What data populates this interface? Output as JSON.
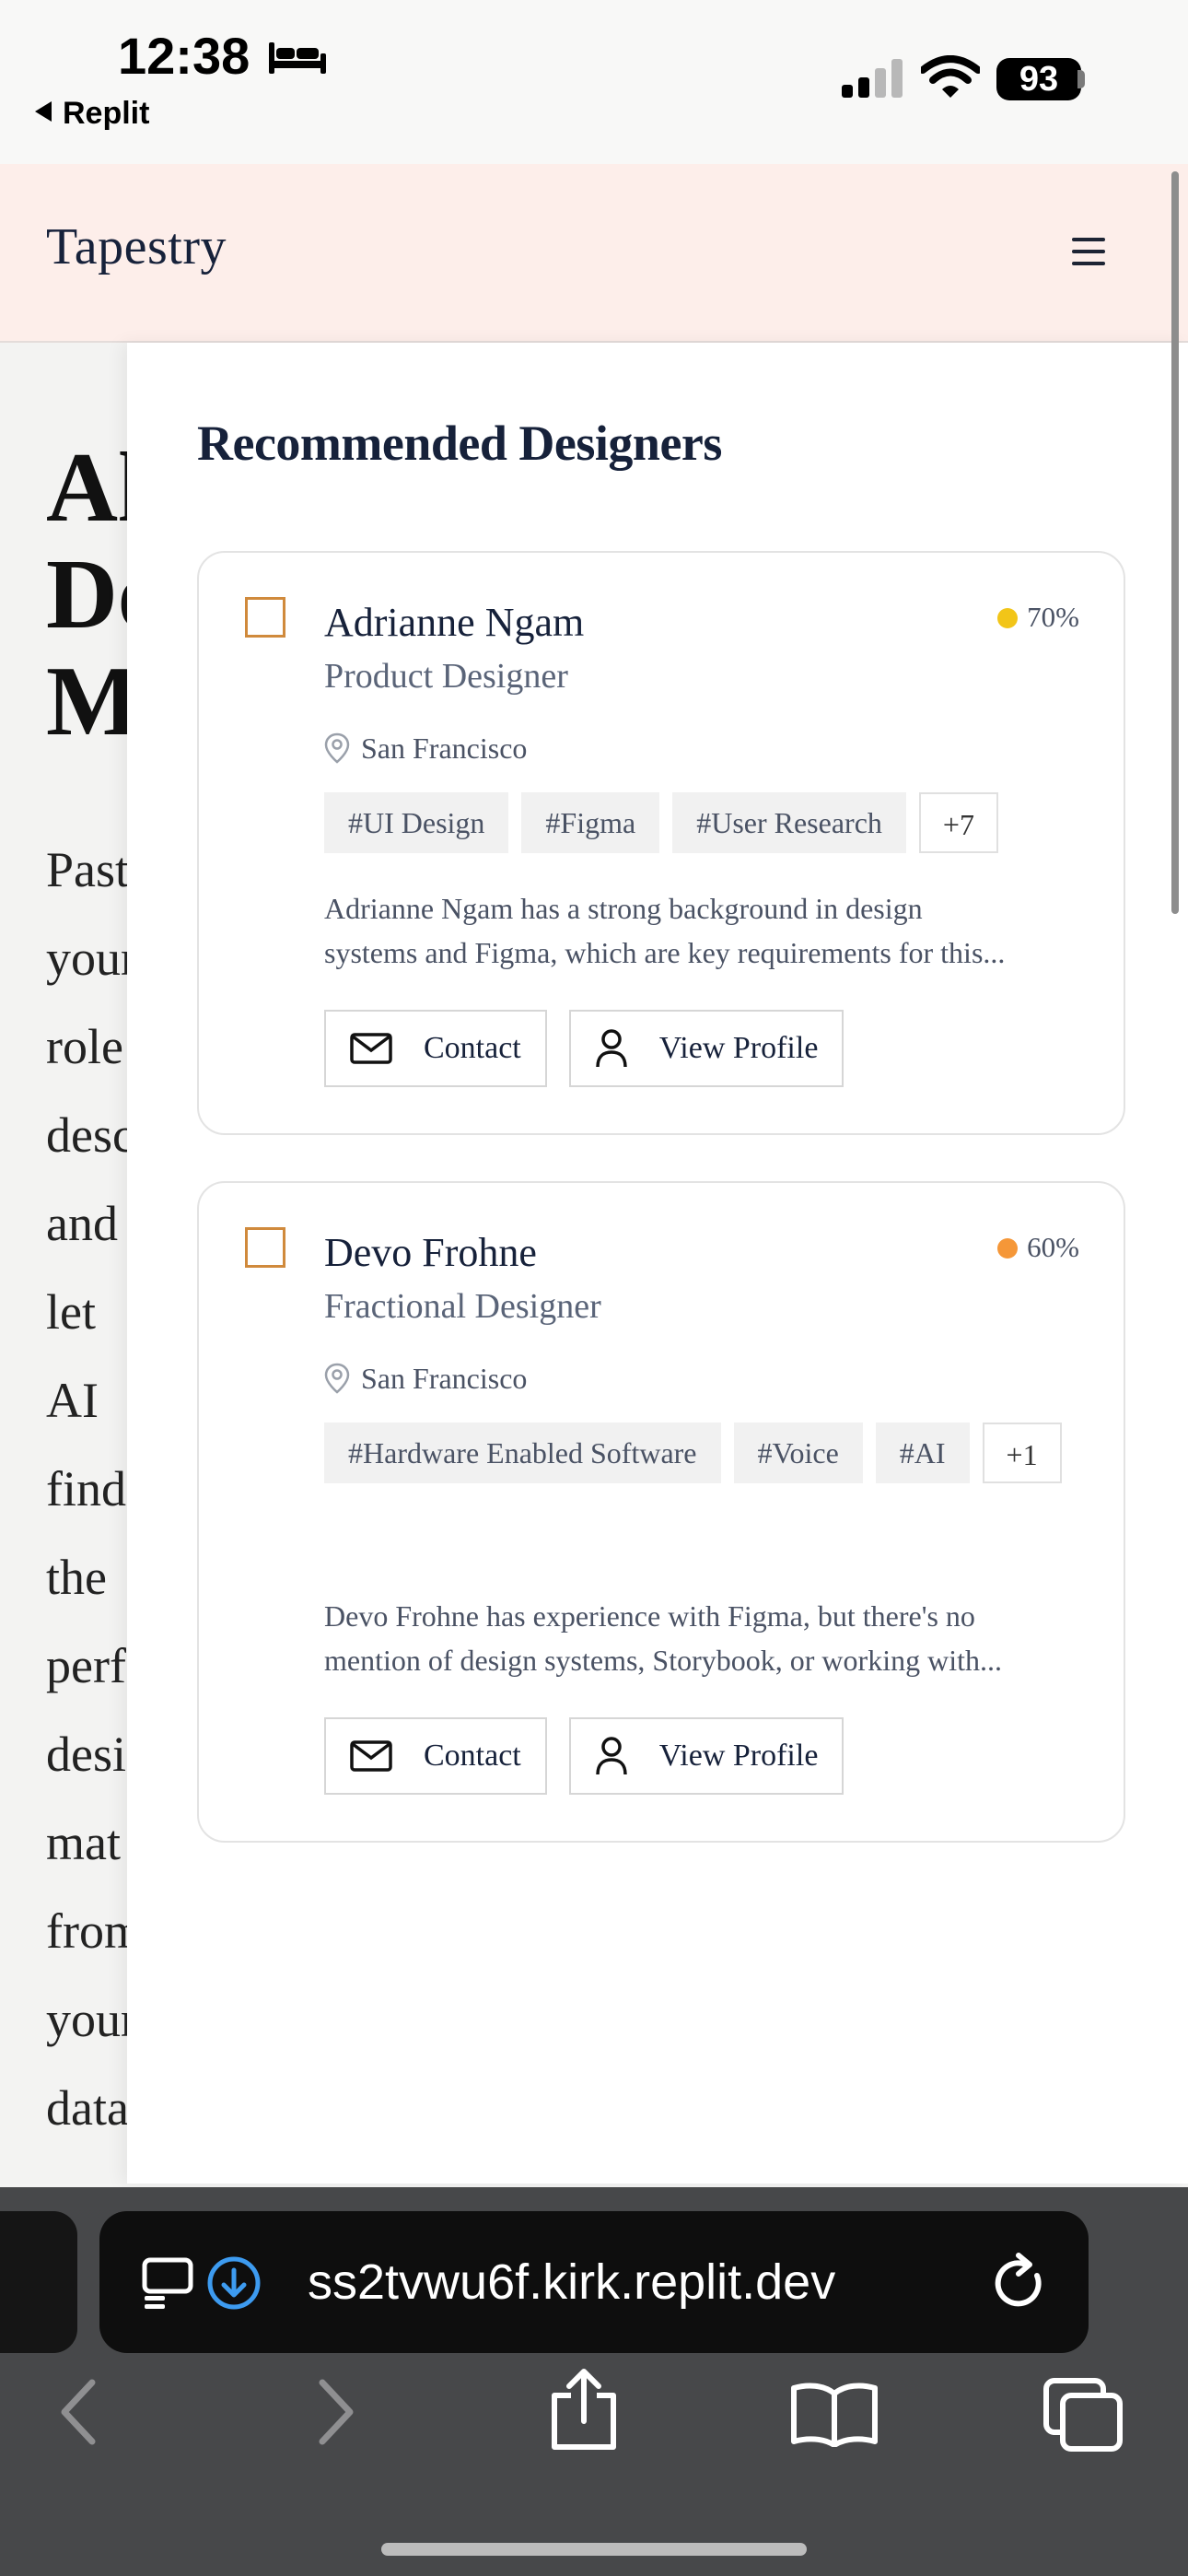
{
  "status_bar": {
    "time": "12:38",
    "back_app": "Replit",
    "battery": "93",
    "icons": [
      "bed-icon",
      "signal-icon",
      "wifi-icon",
      "battery-icon"
    ]
  },
  "header": {
    "brand": "Tapestry",
    "menu_icon": "hamburger-menu-icon"
  },
  "background_page": {
    "title_fragments": [
      "Al",
      "De",
      "M"
    ],
    "subtitle_fragments": [
      "Past",
      "your",
      "role",
      "desc",
      "and",
      "let",
      "AI",
      "find",
      "the",
      "perf",
      "desi",
      "mat",
      "from",
      "your",
      "data"
    ]
  },
  "panel": {
    "title": "Recommended Designers",
    "cards": [
      {
        "name": "Adrianne Ngam",
        "role": "Product Designer",
        "score": "70%",
        "score_color": "#f2c518",
        "location": "San Francisco",
        "tags": [
          "#UI Design",
          "#Figma",
          "#User Research"
        ],
        "more_tags": "+7",
        "description_lines": [
          "Adrianne Ngam has a strong background in design",
          "systems and Figma, which are key requirements for this..."
        ],
        "contact_label": "Contact",
        "profile_label": "View Profile"
      },
      {
        "name": "Devo Frohne",
        "role": "Fractional Designer",
        "score": "60%",
        "score_color": "#f59738",
        "location": "San Francisco",
        "tags": [
          "#Hardware Enabled Software",
          "#Voice",
          "#AI"
        ],
        "more_tags": "+1",
        "description_lines": [
          "Devo Frohne has experience with Figma, but there's no",
          "mention of design systems, Storybook, or working with..."
        ],
        "contact_label": "Contact",
        "profile_label": "View Profile"
      }
    ]
  },
  "safari": {
    "url": "ss2tvwu6f.kirk.replit.dev",
    "icons": [
      "reader-icon",
      "download-icon",
      "reload-icon",
      "back-icon",
      "forward-icon",
      "share-icon",
      "bookmarks-icon",
      "tabs-icon"
    ]
  }
}
